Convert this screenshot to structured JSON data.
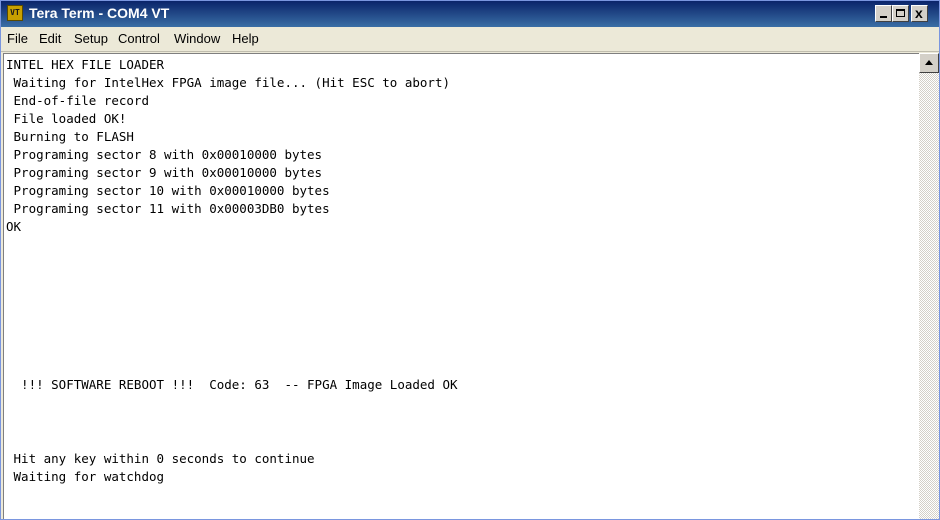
{
  "window": {
    "title": "Tera Term - COM4 VT",
    "icon_label": "VT",
    "controls": {
      "minimize": "_",
      "maximize": "□",
      "close": "x"
    }
  },
  "menu": [
    "File",
    "Edit",
    "Setup",
    "Control",
    "Window",
    "Help"
  ],
  "terminal": {
    "lines": [
      "INTEL HEX FILE LOADER",
      " Waiting for IntelHex FPGA image file... (Hit ESC to abort)",
      " End-of-file record",
      " File loaded OK!",
      " Burning to FLASH",
      " Programing sector 8 with 0x00010000 bytes",
      " Programing sector 9 with 0x00010000 bytes",
      " Programing sector 10 with 0x00010000 bytes",
      " Programing sector 11 with 0x00003DB0 bytes",
      "OK",
      "",
      "",
      "",
      "  !!! SOFTWARE REBOOT !!!  Code: 63  -- FPGA Image Loaded OK",
      "",
      "",
      "",
      " Hit any key within 0 seconds to continue",
      " Waiting for watchdog"
    ]
  },
  "colors": {
    "titlebar_start": "#0a246a",
    "titlebar_end": "#3a6ea5",
    "terminal_bg": "#ffffff",
    "terminal_fg": "#000000"
  }
}
